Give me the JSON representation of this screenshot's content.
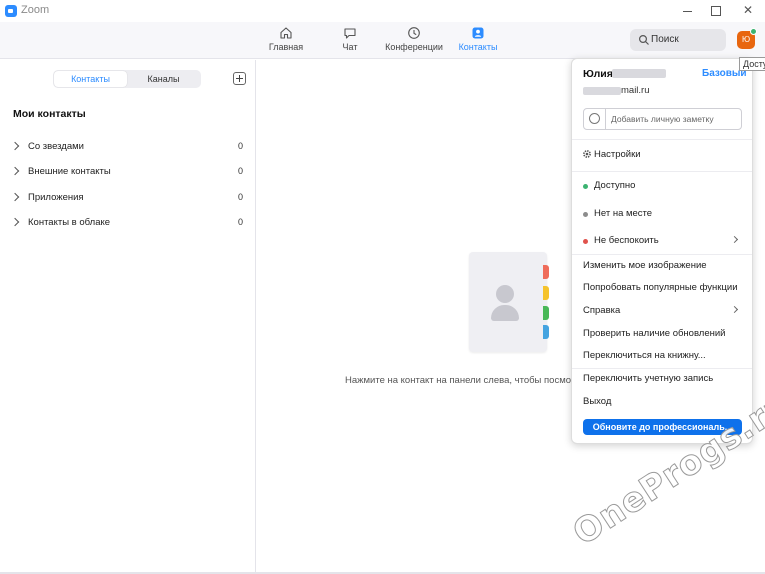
{
  "window": {
    "title": "Zoom"
  },
  "nav": {
    "items": [
      {
        "label": "Главная",
        "icon": "home-icon"
      },
      {
        "label": "Чат",
        "icon": "chat-icon"
      },
      {
        "label": "Конференции",
        "icon": "clock-icon"
      },
      {
        "label": "Контакты",
        "icon": "contacts-icon",
        "active": true
      }
    ],
    "search_label": "Поиск",
    "avatar_initial": "Ю",
    "tooltip": "Доступно"
  },
  "contacts_panel": {
    "tabs": [
      "Контакты",
      "Каналы"
    ],
    "active_tab": "Контакты",
    "section_title": "Мои контакты",
    "groups": [
      {
        "label": "Со звездами",
        "count": "0"
      },
      {
        "label": "Внешние контакты",
        "count": "0"
      },
      {
        "label": "Приложения",
        "count": "0"
      },
      {
        "label": "Контакты в облаке",
        "count": "0"
      }
    ]
  },
  "main": {
    "hint": "Нажмите на контакт на панели слева, чтобы посмотреть информацию о нем",
    "tab_colors": [
      "#ef6c5a",
      "#f5c32c",
      "#49b857",
      "#45a4e0"
    ]
  },
  "profile_menu": {
    "name": "Юлия",
    "plan": "Базовый",
    "email_suffix": "mail.ru",
    "note_placeholder": "Добавить личную заметку",
    "settings": "Настройки",
    "statuses": [
      {
        "label": "Доступно",
        "color": "#3cb371"
      },
      {
        "label": "Нет на месте",
        "color": "#8c8c8c"
      },
      {
        "label": "Не беспокоить",
        "color": "#e0524c"
      }
    ],
    "items": [
      "Изменить мое изображение",
      "Попробовать популярные функции",
      "Справка",
      "Проверить наличие обновлений",
      "Переключиться на книжну..."
    ],
    "account_items": [
      "Переключить учетную запись",
      "Выход"
    ],
    "upgrade_button": "Обновите до профессиональ..."
  },
  "watermark": "OneProgs.ru"
}
